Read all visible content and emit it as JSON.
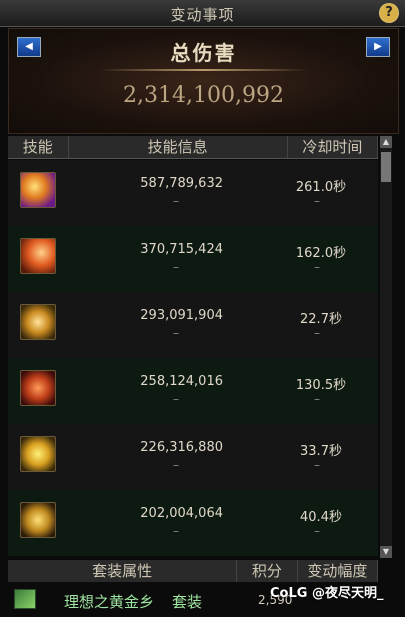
{
  "window": {
    "title": "变动事项",
    "help_icon": "question-icon"
  },
  "header": {
    "title": "总伤害",
    "total_damage": "2,314,100,992",
    "prev_icon": "left-arrow-icon",
    "next_icon": "right-arrow-icon"
  },
  "columns": {
    "skill": "技能",
    "info": "技能信息",
    "cooldown": "冷却时间"
  },
  "rows": [
    {
      "damage": "587,789,632",
      "damage_change": "–",
      "cooldown": "261.0秒",
      "cooldown_change": "–",
      "icon": "skill-icon"
    },
    {
      "damage": "370,715,424",
      "damage_change": "–",
      "cooldown": "162.0秒",
      "cooldown_change": "–",
      "icon": "skill-icon"
    },
    {
      "damage": "293,091,904",
      "damage_change": "–",
      "cooldown": "22.7秒",
      "cooldown_change": "–",
      "icon": "skill-icon"
    },
    {
      "damage": "258,124,016",
      "damage_change": "–",
      "cooldown": "130.5秒",
      "cooldown_change": "–",
      "icon": "skill-icon"
    },
    {
      "damage": "226,316,880",
      "damage_change": "–",
      "cooldown": "33.7秒",
      "cooldown_change": "–",
      "icon": "skill-icon"
    },
    {
      "damage": "202,004,064",
      "damage_change": "–",
      "cooldown": "40.4秒",
      "cooldown_change": "–",
      "icon": "skill-icon"
    }
  ],
  "footer": {
    "col_set": "套装属性",
    "col_score": "积分",
    "col_change": "变动幅度",
    "set_name": "理想之黄金乡",
    "set_tag": "套装",
    "score": "2,590",
    "set_icon": "set-icon"
  },
  "watermark": "CoLG @夜尽天明_"
}
